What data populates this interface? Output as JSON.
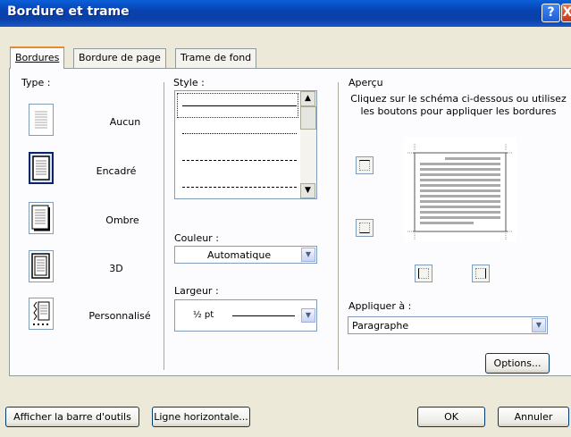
{
  "window": {
    "title": "Bordure et trame"
  },
  "titlebar_buttons": {
    "help": "?",
    "close": "X"
  },
  "tabs": [
    {
      "label": "Bordures",
      "active": true
    },
    {
      "label": "Bordure de page",
      "active": false
    },
    {
      "label": "Trame de fond",
      "active": false
    }
  ],
  "type_section": {
    "label": "Type :",
    "items": [
      {
        "label": "Aucun",
        "selected": false,
        "icon": "none-border-icon"
      },
      {
        "label": "Encadré",
        "selected": true,
        "icon": "box-border-icon"
      },
      {
        "label": "Ombre",
        "selected": false,
        "icon": "shadow-border-icon"
      },
      {
        "label": "3D",
        "selected": false,
        "icon": "3d-border-icon"
      },
      {
        "label": "Personnalisé",
        "selected": false,
        "icon": "custom-border-icon"
      }
    ]
  },
  "style_section": {
    "label": "Style :",
    "options": [
      "solid",
      "dotted",
      "dashed",
      "long-dashed"
    ],
    "color_label": "Couleur :",
    "color_value": "Automatique",
    "width_label": "Largeur :",
    "width_value": "½ pt"
  },
  "preview_section": {
    "label": "Aperçu",
    "hint": "Cliquez sur le schéma ci-dessous ou utilisez les boutons pour appliquer les bordures",
    "apply_label": "Appliquer à :",
    "apply_value": "Paragraphe",
    "options_button": "Options..."
  },
  "footer": {
    "toolbar_button": "Afficher la barre d'outils",
    "horizontal_line_button": "Ligne horizontale...",
    "ok_button": "OK",
    "cancel_button": "Annuler"
  },
  "colors": {
    "titlebar": "#0a4fc8",
    "dialog_bg": "#ece9d8",
    "selected_tab_accent": "#e68b2c"
  }
}
